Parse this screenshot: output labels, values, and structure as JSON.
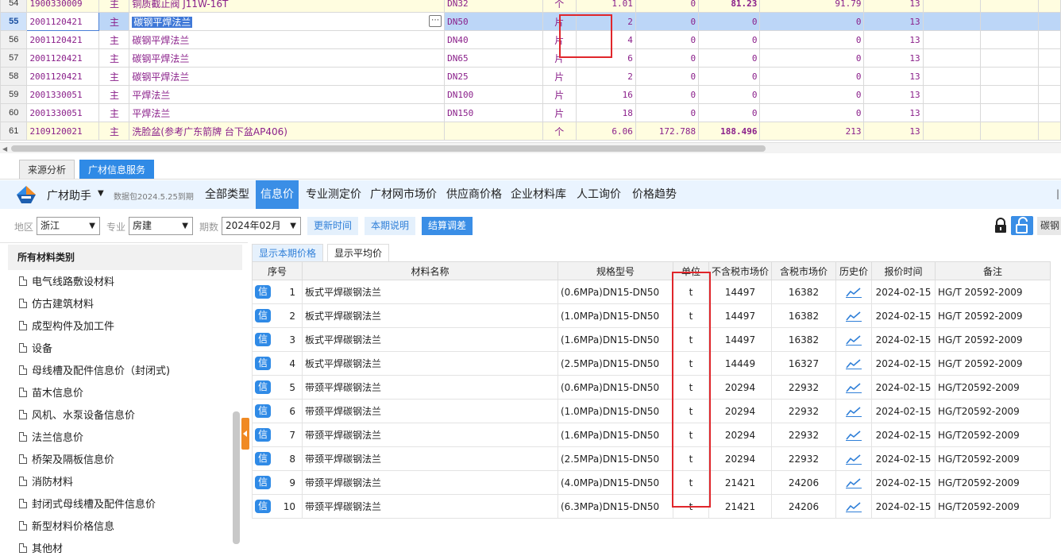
{
  "top_grid": {
    "rows": [
      {
        "no": "54",
        "code": "1900330009",
        "kind": "主",
        "name": "铜质截止阀 J11W-16T",
        "spec": "DN32",
        "unit": "个",
        "qty": "1.01",
        "c2": "0",
        "c3": "81.23",
        "c4": "91.79",
        "c5": "13",
        "style": "yellow"
      },
      {
        "no": "55",
        "code": "2001120421",
        "kind": "主",
        "name": "碳钢平焊法兰",
        "spec": "DN50",
        "unit": "片",
        "qty": "2",
        "c2": "0",
        "c3": "0",
        "c4": "0",
        "c5": "13",
        "style": "sel"
      },
      {
        "no": "56",
        "code": "2001120421",
        "kind": "主",
        "name": "碳钢平焊法兰",
        "spec": "DN40",
        "unit": "片",
        "qty": "4",
        "c2": "0",
        "c3": "0",
        "c4": "0",
        "c5": "13",
        "style": ""
      },
      {
        "no": "57",
        "code": "2001120421",
        "kind": "主",
        "name": "碳钢平焊法兰",
        "spec": "DN65",
        "unit": "片",
        "qty": "6",
        "c2": "0",
        "c3": "0",
        "c4": "0",
        "c5": "13",
        "style": ""
      },
      {
        "no": "58",
        "code": "2001120421",
        "kind": "主",
        "name": "碳钢平焊法兰",
        "spec": "DN25",
        "unit": "片",
        "qty": "2",
        "c2": "0",
        "c3": "0",
        "c4": "0",
        "c5": "13",
        "style": ""
      },
      {
        "no": "59",
        "code": "2001330051",
        "kind": "主",
        "name": "平焊法兰",
        "spec": "DN100",
        "unit": "片",
        "qty": "16",
        "c2": "0",
        "c3": "0",
        "c4": "0",
        "c5": "13",
        "style": ""
      },
      {
        "no": "60",
        "code": "2001330051",
        "kind": "主",
        "name": "平焊法兰",
        "spec": "DN150",
        "unit": "片",
        "qty": "18",
        "c2": "0",
        "c3": "0",
        "c4": "0",
        "c5": "13",
        "style": ""
      },
      {
        "no": "61",
        "code": "2109120021",
        "kind": "主",
        "name": "洗脸盆(参考广东箭牌 台下盆AP406)",
        "spec": "",
        "unit": "个",
        "qty": "6.06",
        "c2": "172.788",
        "c3": "188.496",
        "c4": "213",
        "c5": "13",
        "style": "yellow"
      }
    ]
  },
  "bottom_tabs": [
    "来源分析",
    "广材信息服务"
  ],
  "assistant": {
    "title": "广材助手",
    "package_date": "数据包2024.5.25到期",
    "nav": [
      "全部类型",
      "信息价",
      "专业测定价",
      "广材网市场价",
      "供应商价格",
      "企业材料库",
      "人工询价",
      "价格趋势"
    ],
    "active_nav": "信息价"
  },
  "filters": {
    "region_label": "地区",
    "region": "浙江",
    "major_label": "专业",
    "major": "房建",
    "period_label": "期数",
    "period": "2024年02月",
    "btn_update_time": "更新时间",
    "btn_period_note": "本期说明",
    "btn_settle": "结算调差",
    "edge_text": "碳钢平"
  },
  "categories": {
    "header": "所有材料类别",
    "items": [
      "电气线路敷设材料",
      "仿古建筑材料",
      "成型构件及加工件",
      "设备",
      "母线槽及配件信息价（封闭式)",
      "苗木信息价",
      "风机、水泵设备信息价",
      "法兰信息价",
      "桥架及隔板信息价",
      "消防材料",
      "封闭式母线槽及配件信息价",
      "新型材料价格信息",
      "其他材"
    ]
  },
  "price_tabs": [
    "显示本期价格",
    "显示平均价"
  ],
  "price_table": {
    "columns": [
      "序号",
      "材料名称",
      "规格型号",
      "单位",
      "不含税市场价",
      "含税市场价",
      "历史价",
      "报价时间",
      "备注"
    ],
    "badge": "信",
    "rows": [
      {
        "seq": "1",
        "name": "板式平焊碳钢法兰",
        "spec": "(0.6MPa)DN15-DN50",
        "unit": "t",
        "price_ex": "14497",
        "price_in": "16382",
        "date": "2024-02-15",
        "note": "HG/T 20592-2009"
      },
      {
        "seq": "2",
        "name": "板式平焊碳钢法兰",
        "spec": "(1.0MPa)DN15-DN50",
        "unit": "t",
        "price_ex": "14497",
        "price_in": "16382",
        "date": "2024-02-15",
        "note": "HG/T 20592-2009"
      },
      {
        "seq": "3",
        "name": "板式平焊碳钢法兰",
        "spec": "(1.6MPa)DN15-DN50",
        "unit": "t",
        "price_ex": "14497",
        "price_in": "16382",
        "date": "2024-02-15",
        "note": "HG/T 20592-2009"
      },
      {
        "seq": "4",
        "name": "板式平焊碳钢法兰",
        "spec": "(2.5MPa)DN15-DN50",
        "unit": "t",
        "price_ex": "14449",
        "price_in": "16327",
        "date": "2024-02-15",
        "note": "HG/T 20592-2009"
      },
      {
        "seq": "5",
        "name": "带颈平焊碳钢法兰",
        "spec": "(0.6MPa)DN15-DN50",
        "unit": "t",
        "price_ex": "20294",
        "price_in": "22932",
        "date": "2024-02-15",
        "note": "HG/T20592-2009"
      },
      {
        "seq": "6",
        "name": "带颈平焊碳钢法兰",
        "spec": "(1.0MPa)DN15-DN50",
        "unit": "t",
        "price_ex": "20294",
        "price_in": "22932",
        "date": "2024-02-15",
        "note": "HG/T20592-2009"
      },
      {
        "seq": "7",
        "name": "带颈平焊碳钢法兰",
        "spec": "(1.6MPa)DN15-DN50",
        "unit": "t",
        "price_ex": "20294",
        "price_in": "22932",
        "date": "2024-02-15",
        "note": "HG/T20592-2009"
      },
      {
        "seq": "8",
        "name": "带颈平焊碳钢法兰",
        "spec": "(2.5MPa)DN15-DN50",
        "unit": "t",
        "price_ex": "20294",
        "price_in": "22932",
        "date": "2024-02-15",
        "note": "HG/T20592-2009"
      },
      {
        "seq": "9",
        "name": "带颈平焊碳钢法兰",
        "spec": "(4.0MPa)DN15-DN50",
        "unit": "t",
        "price_ex": "21421",
        "price_in": "24206",
        "date": "2024-02-15",
        "note": "HG/T20592-2009"
      },
      {
        "seq": "10",
        "name": "带颈平焊碳钢法兰",
        "spec": "(6.3MPa)DN15-DN50",
        "unit": "t",
        "price_ex": "21421",
        "price_in": "24206",
        "date": "2024-02-15",
        "note": "HG/T20592-2009"
      }
    ]
  },
  "icons": {
    "logo": "guangcai-logo-icon",
    "lock": "lock-icon",
    "unlock": "unlock-icon",
    "trend": "trend-chart-icon",
    "doc": "document-icon"
  },
  "colors": {
    "accent": "#3a8ee6",
    "highlight_box": "#e0262b",
    "row_text": "#8a1f8a",
    "yellow_row": "#fffde0",
    "selected_row": "#bcd6f7"
  }
}
